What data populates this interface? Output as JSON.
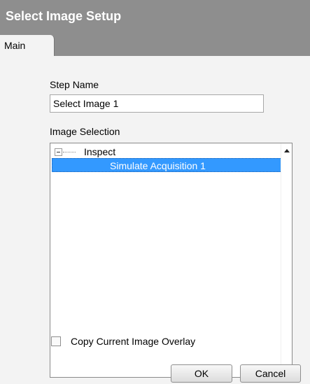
{
  "window": {
    "title": "Select Image Setup"
  },
  "tabs": [
    {
      "label": "Main"
    }
  ],
  "form": {
    "step_name_label": "Step Name",
    "step_name_value": "Select Image 1",
    "image_selection_label": "Image Selection",
    "tree": {
      "root_label": "Inspect",
      "selected_child_label": "Simulate Acquisition 1"
    },
    "copy_overlay_label": "Copy Current Image Overlay",
    "copy_overlay_checked": false
  },
  "buttons": {
    "ok": "OK",
    "cancel": "Cancel"
  },
  "colors": {
    "titlebar": "#8e8e8e",
    "selection": "#3399ff",
    "panel": "#f3f3f3"
  },
  "icons": [
    "collapse-icon",
    "scroll-up-arrow-icon",
    "scroll-down-arrow-icon"
  ]
}
